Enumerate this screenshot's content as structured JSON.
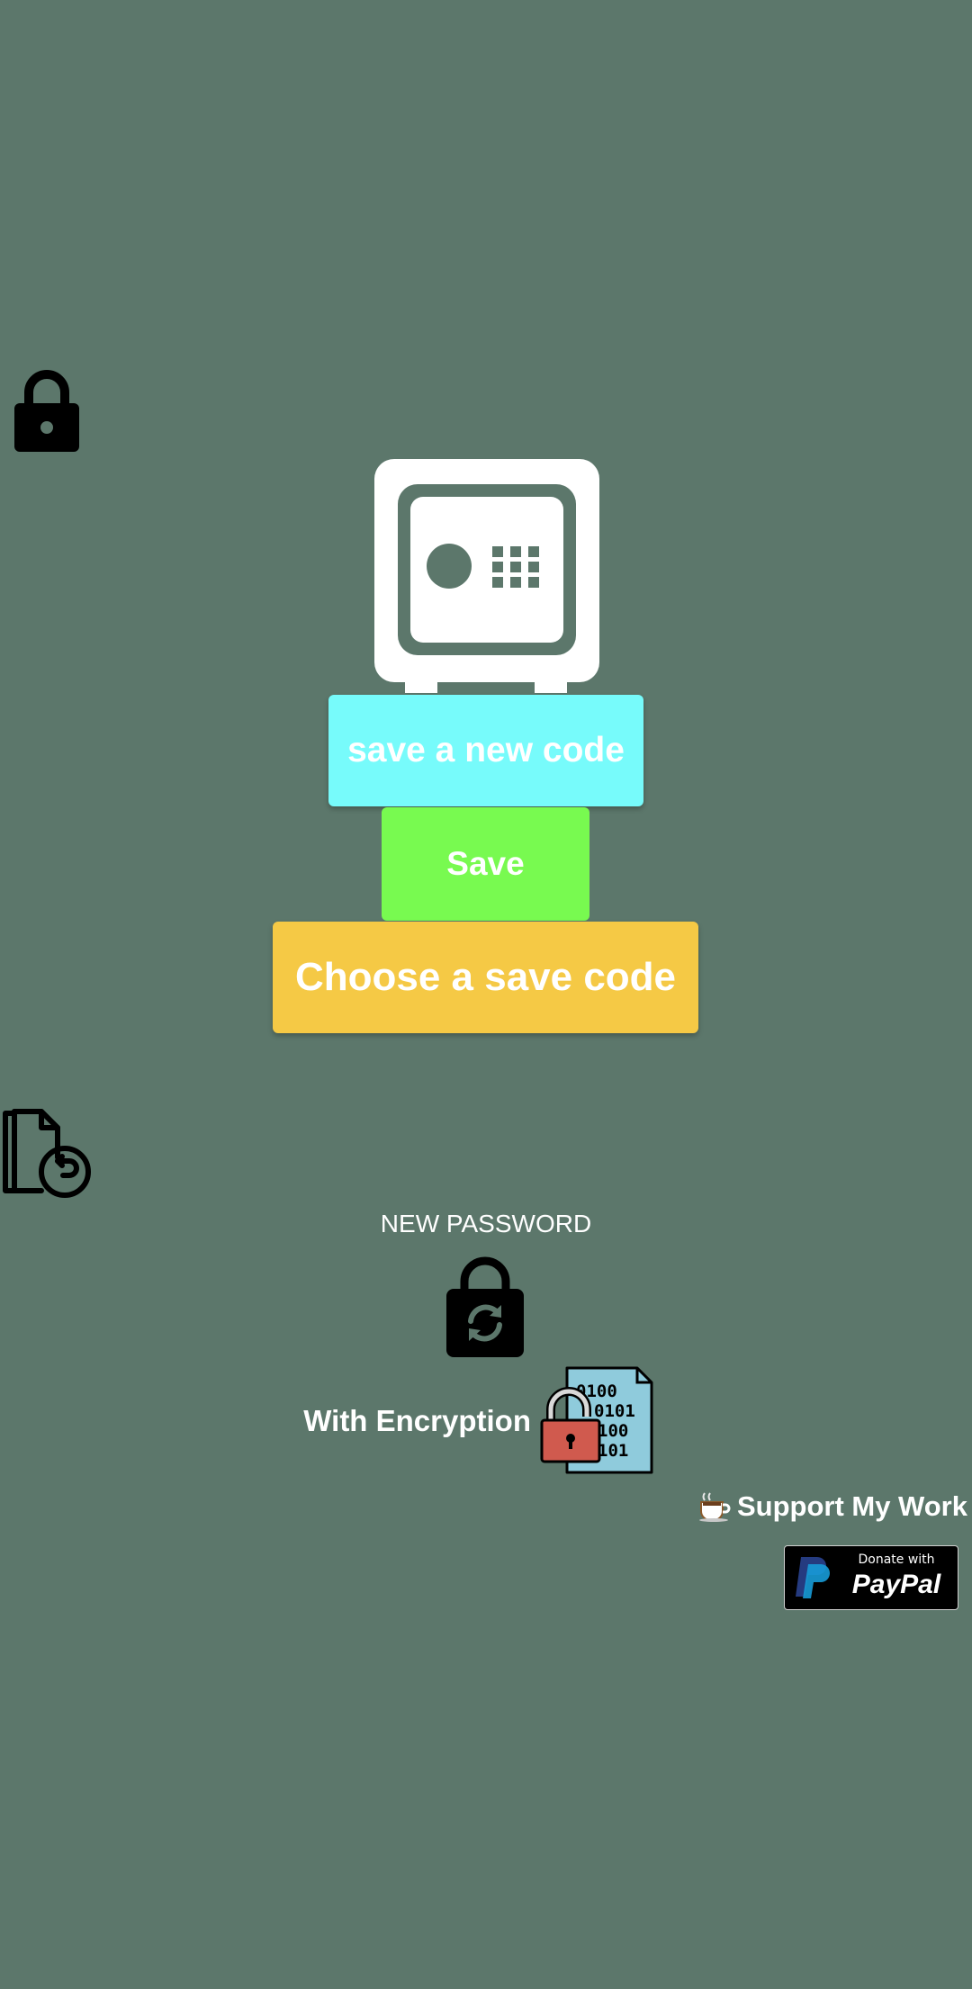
{
  "buttons": {
    "new_code": "save a new code",
    "save": "Save",
    "choose_code": "Choose a save code"
  },
  "labels": {
    "new_password": "NEW PASSWORD",
    "with_encryption": "With Encryption",
    "support": "Support My Work"
  },
  "paypal": {
    "small": "Donate with",
    "big": "PayPal"
  },
  "icons": {
    "top_left": "lock-icon",
    "hero": "safe-icon",
    "restore": "file-restore-icon",
    "new_password": "lock-refresh-icon",
    "encryption": "encrypted-file-icon",
    "support": "coffee-cup-icon",
    "paypal": "paypal-logo-icon"
  },
  "colors": {
    "background": "#5c776b",
    "new_code_button": "#77fbfb",
    "save_button": "#78fa50",
    "choose_button": "#f5c945",
    "text": "#ffffff"
  }
}
